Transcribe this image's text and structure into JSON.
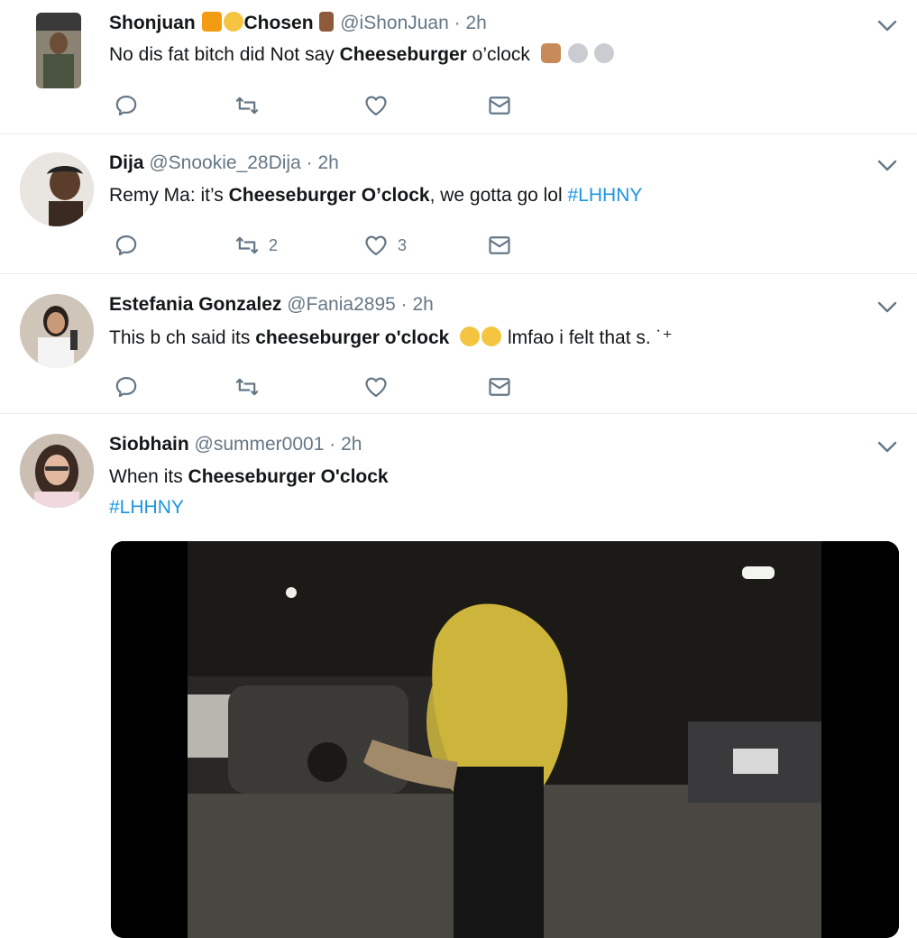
{
  "tweets": [
    {
      "name": "Shonjuan",
      "name_suffix": "Chosen",
      "handle": "@iShonJuan",
      "time": "2h",
      "text_before": "No dis fat bitch did Not say ",
      "text_bold": "Cheeseburger",
      "text_after": " o’clock",
      "reply_count": "",
      "retweet_count": "",
      "like_count": ""
    },
    {
      "name": "Dija",
      "handle": "@Snookie_28Dija",
      "time": "2h",
      "text_before": "Remy Ma: it’s ",
      "text_bold": "Cheeseburger O’clock",
      "text_after": ", we gotta go lol ",
      "hashtag": "#LHHNY",
      "reply_count": "",
      "retweet_count": "2",
      "like_count": "3"
    },
    {
      "name": "Estefania Gonzalez",
      "handle": "@Fania2895",
      "time": "2h",
      "text_before": "This b  ch said its ",
      "text_bold": "cheeseburger o'clock",
      "text_after": " lmfao i felt that s. ˙⁺",
      "reply_count": "",
      "retweet_count": "",
      "like_count": ""
    },
    {
      "name": "Siobhain",
      "handle": "@summer0001",
      "time": "2h",
      "text_before": "When its ",
      "text_bold": "Cheeseburger O'clock",
      "hashtag": "#LHHNY"
    }
  ],
  "separator": "·",
  "icons": {
    "reply": "reply-icon",
    "retweet": "retweet-icon",
    "like": "heart-icon",
    "dm": "envelope-icon",
    "more": "chevron-down-icon"
  },
  "colors": {
    "link": "#1b95e0",
    "secondary": "#657786",
    "divider": "#e6ecf0"
  }
}
